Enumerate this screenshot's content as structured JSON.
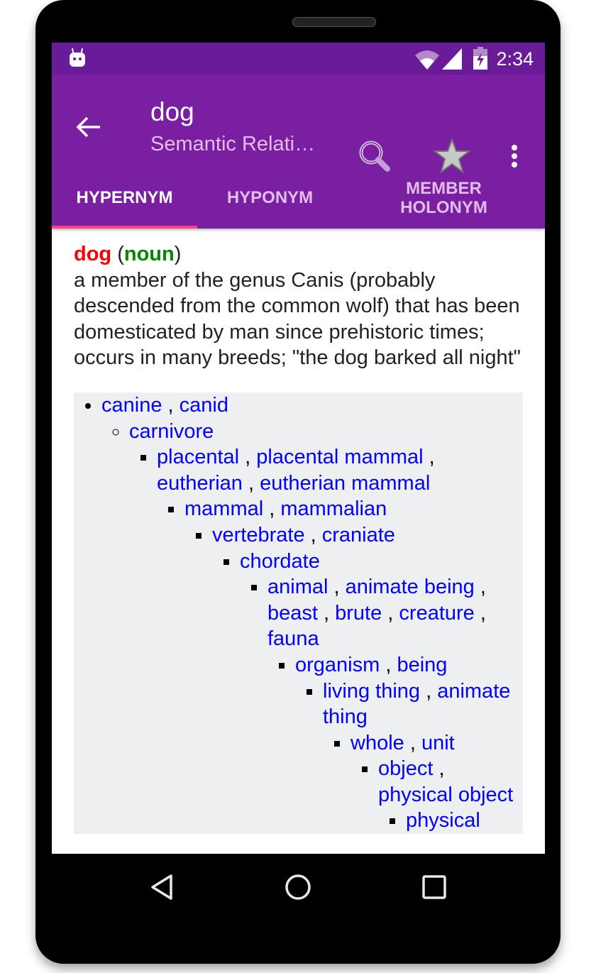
{
  "status_bar": {
    "time": "2:34",
    "icons": [
      "android-icon",
      "wifi-icon",
      "signal-icon",
      "battery-charging-icon"
    ]
  },
  "toolbar": {
    "title": "dog",
    "subtitle": "Semantic Relati…",
    "back_icon": "arrow-left-icon",
    "actions": [
      "search-icon",
      "star-icon",
      "more-vert-icon"
    ]
  },
  "tabs": [
    {
      "label": "HYPERNYM",
      "active": true
    },
    {
      "label": "HYPONYM",
      "active": false
    },
    {
      "label": "MEMBER HOLONYM",
      "active": false
    }
  ],
  "entry": {
    "word": "dog",
    "pos": "noun",
    "definition": "a member of the genus Canis (probably descended from the common wolf) that has been domesticated by man since prehistoric times; occurs in many breeds; \"the dog barked all night\""
  },
  "colors": {
    "status_bar": "#6a1b9a",
    "toolbar": "#7b1fa2",
    "tab_indicator": "#ff4081",
    "word": "#ff0000",
    "pos": "#008800",
    "link": "#0000ff"
  },
  "tree": [
    {
      "terms": [
        "canine",
        "canid"
      ],
      "children": [
        {
          "terms": [
            "carnivore"
          ],
          "children": [
            {
              "terms": [
                "placental",
                "placental mammal",
                "eutherian",
                "eutherian mammal"
              ],
              "children": [
                {
                  "terms": [
                    "mammal",
                    "mammalian"
                  ],
                  "children": [
                    {
                      "terms": [
                        "vertebrate",
                        "craniate"
                      ],
                      "children": [
                        {
                          "terms": [
                            "chordate"
                          ],
                          "children": [
                            {
                              "terms": [
                                "animal",
                                "animate being",
                                "beast",
                                "brute",
                                "creature",
                                "fauna"
                              ],
                              "children": [
                                {
                                  "terms": [
                                    "organism",
                                    "being"
                                  ],
                                  "children": [
                                    {
                                      "terms": [
                                        "living thing",
                                        "animate thing"
                                      ],
                                      "children": [
                                        {
                                          "terms": [
                                            "whole",
                                            "unit"
                                          ],
                                          "children": [
                                            {
                                              "terms": [
                                                "object",
                                                "physical object"
                                              ],
                                              "children": [
                                                {
                                                  "terms": [
                                                    "physical"
                                                  ],
                                                  "children": []
                                                }
                                              ]
                                            }
                                          ]
                                        }
                                      ]
                                    }
                                  ]
                                }
                              ]
                            }
                          ]
                        }
                      ]
                    }
                  ]
                }
              ]
            }
          ]
        }
      ]
    }
  ],
  "navbar": [
    "back-triangle-icon",
    "home-circle-icon",
    "recents-square-icon"
  ]
}
